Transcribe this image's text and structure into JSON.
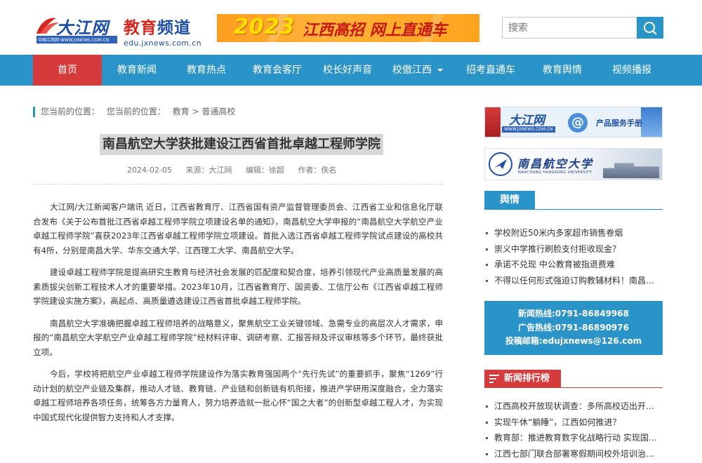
{
  "header": {
    "logo_name": "大江网",
    "logo_url": "中国江西网 WWW.JXNEWS.COM.CN",
    "channel_title_red": "教育",
    "channel_title_blue": "频道",
    "channel_url": "edu.jxnews.com.cn",
    "banner_year": "2023",
    "banner_text": "江西高招 网上直通车",
    "search_placeholder": "搜索"
  },
  "nav": {
    "items": [
      {
        "label": "首页",
        "active": true
      },
      {
        "label": "教育新闻"
      },
      {
        "label": "教育热点"
      },
      {
        "label": "教育会客厅"
      },
      {
        "label": "校长好声音"
      },
      {
        "label": "校傲江西"
      },
      {
        "label": "招考直通车"
      },
      {
        "label": "教育舆情"
      },
      {
        "label": "视频播报"
      }
    ]
  },
  "breadcrumb": {
    "prefix": "您当前的位置：",
    "prefix2": "您当前的位置：",
    "path": "教育 > 普通高校"
  },
  "article": {
    "title": "南昌航空大学获批建设江西省首批卓越工程师学院",
    "date": "2024-02-05",
    "source": "来源：大江网",
    "editor": "编辑：徐超",
    "author": "作者：佚名",
    "paragraphs": [
      "大江网/大江新闻客户端讯 近日，江西省教育厅、江西省国有资产监督管理委员会、江西省工业和信息化厅联合发布《关于公布首批江西省卓越工程师学院立项建设名单的通知》，南昌航空大学申报的“南昌航空大学航空产业卓越工程师学院”喜获2023年江西省卓越工程师学院立项建设。首批入选江西省卓越工程师学院试点建设的高校共有4所，分别是南昌大学、华东交通大学、江西理工大学、南昌航空大学。",
      "建设卓越工程师学院是提高研究生教育与经济社会发展的匹配度和契合度，培养引领现代产业高质量发展的高素质拔尖创新工程技术人才的重要举措。2023年10月，江西省教育厅、国资委、工信厅公布《江西省卓越工程师学院建设实施方案》，高起点、高质量遴选建设江西省首批卓越工程师学院。",
      "南昌航空大学准确把握卓越工程师培养的战略意义，聚焦航空工业关键领域、急需专业的高层次人才需求，申报的“南昌航空大学航空产业卓越工程师学院”经材料评审、调研考察、汇报答辩及评议审核等多个环节，最终获批立项。",
      "今后，学校将把航空产业卓越工程师学院建设作为落实教育强国两个“先行先试”的重要抓手，聚焦“1269”行动计划的航空产业链及集群，推动人才链、教育链、产业链和创新链有机衔接，推进产学研用深度融合，全力落实卓越工程师培养各项任务，统筹各方力量育人，努力培养造就一批心怀“国之大者”的创新型卓越工程人才，为实现中国式现代化提供智力支持和人才支撑。"
    ]
  },
  "sidebar": {
    "ad1_name": "大江网",
    "ad1_url": "WWW.JXNEWS.COM.CN",
    "ad1_text": "产品服务手册",
    "ad2_name": "南昌航空大学",
    "ad2_en": "NANCHANG HANGKONG UNIVERSITY",
    "yuqing_title": "舆情",
    "yuqing_items": [
      "学校附近50米内多家超市销售卷烟",
      "崇义中学推行刷脸支付拒收现金？",
      "承诺不兑现 中公教育被指退费难",
      "不得以任何形式强迫订购教辅材料！南昌县教育体育局发布通知"
    ],
    "hotline_news": "新闻热线:0791-86849968",
    "hotline_ad": "广告热线:0791-86890976",
    "hotline_mail": "投稿邮箱:edujxnews@126.com",
    "rank_title": "新闻排行榜",
    "rank_items": [
      "江西高校开放现状调查：多所高校迈出开放第一步",
      "实现午休“躺睡”，江西如何推进？",
      "教育部：推进教育数字化战略行动 实现国家智慧教育平台全覆盖",
      "江西七部门联合部署寒假期间校外培训治理工作"
    ]
  },
  "colors": {
    "nav_blue": "#2a93c8",
    "nav_active_red": "#d63a3a",
    "title_bg": "#d7d7d7"
  }
}
